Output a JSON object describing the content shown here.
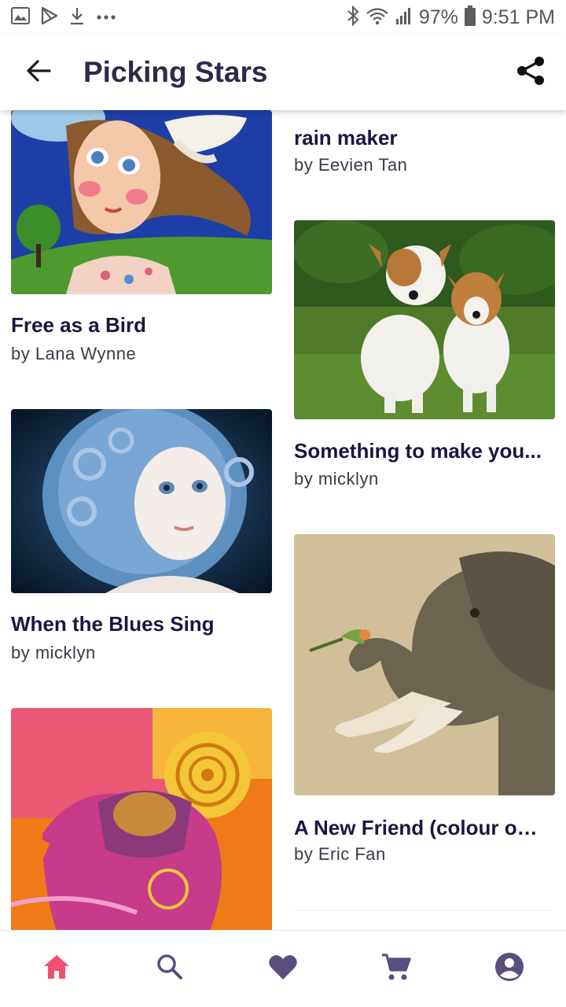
{
  "status_bar": {
    "battery": "97%",
    "time": "9:51 PM",
    "left_icons": [
      "image-icon",
      "play-store-icon",
      "download-icon",
      "more-dots-icon"
    ],
    "right_icons": [
      "bluetooth-icon",
      "wifi-icon",
      "signal-icon",
      "battery-icon"
    ]
  },
  "app_bar": {
    "title": "Picking Stars",
    "back_icon": "arrow-back-icon",
    "share_icon": "share-icon"
  },
  "artworks": [
    {
      "title": "Free as a Bird",
      "author": "by Lana Wynne",
      "image": "woman-with-bird-painting"
    },
    {
      "title": "rain maker",
      "author": "by Eevien Tan",
      "image": ""
    },
    {
      "title": "When the Blues Sing",
      "author": "by micklyn",
      "image": "blue-haired-girl-portrait"
    },
    {
      "title": "Something to make you...",
      "author": "by micklyn",
      "image": "two-dogs-on-grass"
    },
    {
      "title": "",
      "author": "",
      "image": "pink-elephant-collage"
    },
    {
      "title": "A New Friend (colour op...",
      "author": "by Eric Fan",
      "image": "elephant-with-bird"
    }
  ],
  "bottom_nav": [
    {
      "name": "home",
      "icon": "home-icon",
      "active": true
    },
    {
      "name": "search",
      "icon": "search-icon",
      "active": false
    },
    {
      "name": "favorites",
      "icon": "heart-icon",
      "active": false
    },
    {
      "name": "cart",
      "icon": "cart-icon",
      "active": false
    },
    {
      "name": "account",
      "icon": "account-icon",
      "active": false
    }
  ],
  "colors": {
    "title": "#2b2a4c",
    "nav_active": "#f0506e",
    "nav_inactive": "#5a4e7c"
  }
}
